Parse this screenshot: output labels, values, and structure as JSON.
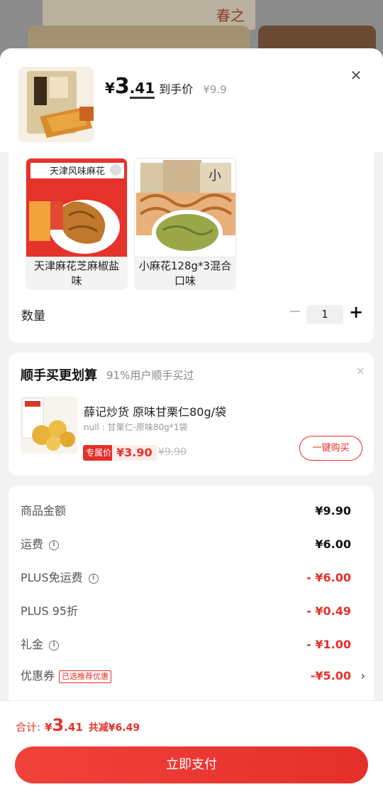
{
  "background": {
    "banner_text": "春之恋"
  },
  "product": {
    "currency": "¥",
    "price_int": "3",
    "price_dec": ".41",
    "price_suffix": "到手价",
    "original_price": "¥9.9"
  },
  "options": [
    {
      "label": "天津麻花芝麻椒盐味",
      "package_text": "天津风味麻花",
      "selected": false
    },
    {
      "label": "小麻花128g*3混合口味",
      "package_text": "小",
      "selected": false
    }
  ],
  "quantity": {
    "label": "数量",
    "minus": "−",
    "value": "1",
    "plus": "+"
  },
  "addon": {
    "title": "顺手买更划算",
    "subtitle": "91%用户顺手买过",
    "close": "×",
    "name": "薛记炒货 原味甘栗仁80g/袋",
    "spec": "null : 甘栗仁-原味80g*1袋",
    "badge": "专属价",
    "price": "¥3.90",
    "original_price": "¥9.90",
    "button": "一键购买"
  },
  "summary": {
    "rows": [
      {
        "label": "商品金额",
        "value": "¥9.90",
        "info": false
      },
      {
        "label": "运费",
        "value": "¥6.00",
        "info": true
      },
      {
        "label": "PLUS免运费",
        "value": "- ¥6.00",
        "info": true
      },
      {
        "label": "PLUS 95折",
        "value": "- ¥0.49",
        "info": false
      },
      {
        "label": "礼金",
        "value": "- ¥1.00",
        "info": true
      },
      {
        "label": "优惠券",
        "value": "-¥5.00",
        "info": false
      }
    ],
    "coupon_tag": "已选推荐优惠",
    "coupon_chevron": "›"
  },
  "footer": {
    "total_label": "合计:",
    "total_yuan": "¥",
    "total_int": "3",
    "total_dec": ".41",
    "savings": "共减¥6.49",
    "pay_button": "立即支付"
  },
  "colors": {
    "accent": "#e5302a",
    "sheet_bg": "#f2f2f2"
  }
}
